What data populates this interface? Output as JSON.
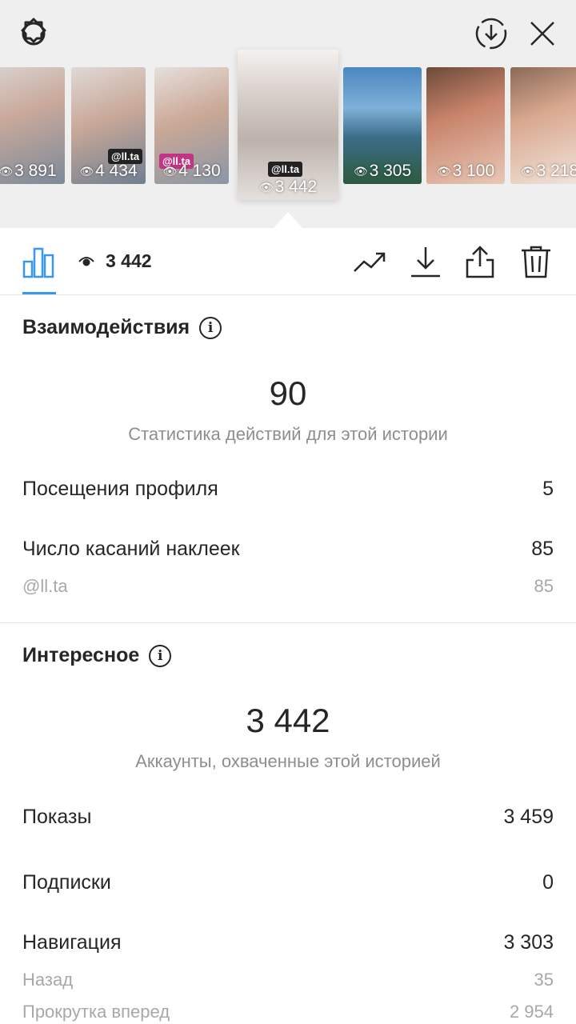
{
  "topbar": {
    "settings_icon": "settings-gear-icon",
    "download_icon": "download-circle-icon",
    "close_icon": "close-icon"
  },
  "stories": [
    {
      "count": "3 891"
    },
    {
      "count": "4 434",
      "sticker": "@ll.ta"
    },
    {
      "count": "4 130",
      "sticker": "@ll.ta"
    },
    {
      "count": "3 442",
      "sticker": "@ll.ta",
      "selected": true
    },
    {
      "count": "3 305"
    },
    {
      "count": "3 100"
    },
    {
      "count": "3 218"
    }
  ],
  "toolbar": {
    "views": "3 442",
    "accent": "#3897f0"
  },
  "interactions": {
    "title": "Взаимодействия",
    "total": "90",
    "total_caption": "Статистика действий для этой истории",
    "rows": [
      {
        "label": "Посещения профиля",
        "value": "5"
      },
      {
        "label": "Число касаний наклеек",
        "value": "85"
      }
    ],
    "sub_rows": [
      {
        "label": "@ll.ta",
        "value": "85"
      }
    ]
  },
  "discovery": {
    "title": "Интересное",
    "total": "3 442",
    "total_caption": "Аккаунты, охваченные этой историей",
    "rows": [
      {
        "label": "Показы",
        "value": "3 459"
      },
      {
        "label": "Подписки",
        "value": "0"
      },
      {
        "label": "Навигация",
        "value": "3 303"
      }
    ],
    "sub_rows": [
      {
        "label": "Назад",
        "value": "35"
      },
      {
        "label": "Прокрутка вперед",
        "value": "2 954"
      }
    ]
  }
}
